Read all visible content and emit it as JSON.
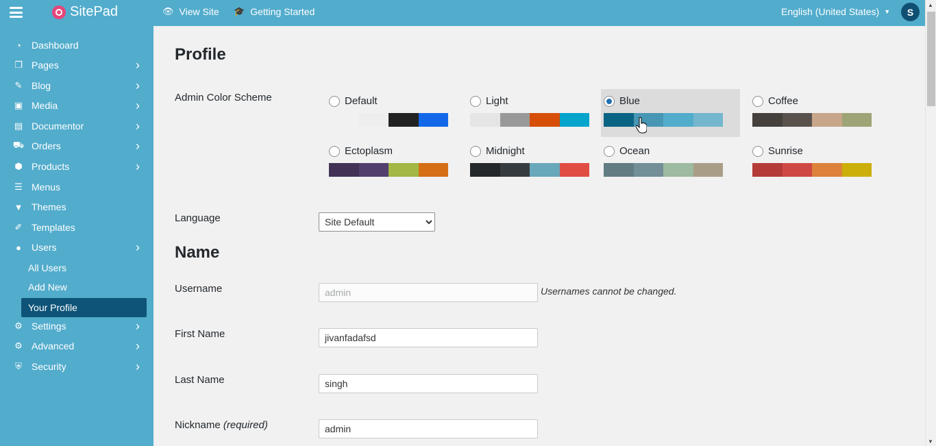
{
  "topbar": {
    "brand": "SitePad",
    "view_site": "View Site",
    "getting_started": "Getting Started",
    "language": "English (United States)",
    "avatar_letter": "S"
  },
  "sidebar": {
    "items": [
      {
        "label": "Dashboard",
        "icon": "dashboard-icon",
        "glyph": "◔",
        "chevron": false
      },
      {
        "label": "Pages",
        "icon": "pages-icon",
        "glyph": "❐",
        "chevron": true
      },
      {
        "label": "Blog",
        "icon": "pin-icon",
        "glyph": "✎",
        "chevron": true
      },
      {
        "label": "Media",
        "icon": "media-icon",
        "glyph": "▣",
        "chevron": true
      },
      {
        "label": "Documentor",
        "icon": "document-icon",
        "glyph": "▤",
        "chevron": true
      },
      {
        "label": "Orders",
        "icon": "cart-icon",
        "glyph": "⛟",
        "chevron": true
      },
      {
        "label": "Products",
        "icon": "box-icon",
        "glyph": "⬢",
        "chevron": true
      },
      {
        "label": "Menus",
        "icon": "menus-icon",
        "glyph": "☰",
        "chevron": false
      },
      {
        "label": "Themes",
        "icon": "brush-icon",
        "glyph": "▼",
        "chevron": false
      },
      {
        "label": "Templates",
        "icon": "pen-icon",
        "glyph": "✐",
        "chevron": false
      },
      {
        "label": "Users",
        "icon": "user-icon",
        "glyph": "●",
        "chevron": true
      },
      {
        "label": "Settings",
        "icon": "settings-icon",
        "glyph": "⚙",
        "chevron": true
      },
      {
        "label": "Advanced",
        "icon": "gear-icon",
        "glyph": "⚙",
        "chevron": true
      },
      {
        "label": "Security",
        "icon": "shield-icon",
        "glyph": "⛨",
        "chevron": true
      }
    ],
    "sub_items": [
      {
        "label": "All Users",
        "active": false
      },
      {
        "label": "Add New",
        "active": false
      },
      {
        "label": "Your Profile",
        "active": true
      }
    ]
  },
  "main": {
    "page_title": "Profile",
    "color_scheme_label": "Admin Color Scheme",
    "schemes": [
      {
        "name": "Default",
        "selected": false,
        "colors": [
          "#eeeeee",
          "#222222",
          "#1368ea",
          null
        ]
      },
      {
        "name": "Light",
        "selected": false,
        "colors": [
          "#e5e5e5",
          "#999999",
          "#d64e07",
          "#04a4cc"
        ]
      },
      {
        "name": "Blue",
        "selected": true,
        "colors": [
          "#096484",
          "#4796b3",
          "#52accc",
          "#74b6ce"
        ]
      },
      {
        "name": "Coffee",
        "selected": false,
        "colors": [
          "#46403c",
          "#59524c",
          "#c7a589",
          "#9ea476"
        ]
      },
      {
        "name": "Ectoplasm",
        "selected": false,
        "colors": [
          "#413256",
          "#523f6d",
          "#a3b745",
          "#d46f15"
        ]
      },
      {
        "name": "Midnight",
        "selected": false,
        "colors": [
          "#25282b",
          "#363b3f",
          "#69a8bb",
          "#e14d43"
        ]
      },
      {
        "name": "Ocean",
        "selected": false,
        "colors": [
          "#627c83",
          "#738e96",
          "#9ebaa0",
          "#aa9d88"
        ]
      },
      {
        "name": "Sunrise",
        "selected": false,
        "colors": [
          "#b43c38",
          "#cf4944",
          "#dd823b",
          "#ccaf0b"
        ]
      }
    ],
    "language_label": "Language",
    "language_value": "Site Default",
    "name_section_title": "Name",
    "username_label": "Username",
    "username_value": "admin",
    "username_desc": "Usernames cannot be changed.",
    "first_name_label": "First Name",
    "first_name_value": "jivanfadafsd",
    "last_name_label": "Last Name",
    "last_name_value": "singh",
    "nickname_label": "Nickname",
    "nickname_required": "(required)",
    "nickname_value": "admin"
  }
}
